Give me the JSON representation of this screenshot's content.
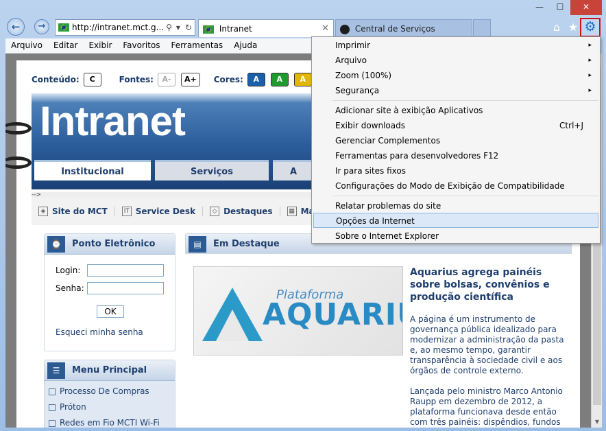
{
  "window": {
    "minimize": "—",
    "maximize": "☐",
    "close": "✕"
  },
  "nav": {
    "back": "←",
    "forward": "→",
    "address": "http://intranet.mct.g...",
    "search_icon": "⚲",
    "dropdown_icon": "▾",
    "refresh_icon": "↻"
  },
  "tabs": [
    {
      "label": "Intranet",
      "close": "✕"
    },
    {
      "label": "Central de Serviços"
    }
  ],
  "toolbar": {
    "home_icon": "⌂",
    "favorites_icon": "★",
    "tools_icon": "⚙"
  },
  "menubar": [
    "Arquivo",
    "Editar",
    "Exibir",
    "Favoritos",
    "Ferramentas",
    "Ajuda"
  ],
  "access_bar": {
    "content_label": "Conteúdo:",
    "content_btn": "C",
    "fonts_label": "Fontes:",
    "font_minus": "A-",
    "font_plus": "A+",
    "colors_label": "Cores:",
    "colors": [
      {
        "label": "A",
        "color": "#1a5fa8"
      },
      {
        "label": "A",
        "color": "#1e9a2e"
      },
      {
        "label": "A",
        "color": "#e3b600"
      }
    ]
  },
  "banner": {
    "title": "Intranet"
  },
  "site_tabs": [
    "Institucional",
    "Serviços",
    "A"
  ],
  "arrow_text": "-->",
  "quick_links": [
    "Site do MCT",
    "Service Desk",
    "Destaques",
    "Map"
  ],
  "ponto": {
    "title": "Ponto Eletrônico",
    "login_label": "Login:",
    "senha_label": "Senha:",
    "ok": "OK",
    "forgot": "Esqueci minha senha"
  },
  "menu_principal": {
    "title": "Menu Principal",
    "items": [
      "Processo De Compras",
      "Próton",
      "Redes em Fio MCTI Wi-Fi"
    ]
  },
  "destaque": {
    "title": "Em Destaque",
    "image_top": "Plataforma",
    "image_main": "AQUARIUS",
    "headline": "Aquarius agrega painéis sobre bolsas, convênios e produção científica",
    "para1": "A página é um instrumento de governança pública idealizado para modernizar a administração da pasta e, ao mesmo tempo, garantir transparência à sociedade civil e aos órgãos de controle externo.",
    "para2": "Lançada pelo ministro Marco Antonio Raupp em dezembro de 2012, a plataforma funcionava desde então com três painéis: dispêndios, fundos"
  },
  "tools_menu": {
    "items": [
      {
        "label": "Imprimir",
        "submenu": "▸"
      },
      {
        "label": "Arquivo",
        "submenu": "▸"
      },
      {
        "label": "Zoom (100%)",
        "submenu": "▸"
      },
      {
        "label": "Segurança",
        "submenu": "▸"
      },
      {
        "label": "Adicionar site à exibição Aplicativos"
      },
      {
        "label": "Exibir downloads",
        "shortcut": "Ctrl+J"
      },
      {
        "label": "Gerenciar Complementos"
      },
      {
        "label": "Ferramentas para desenvolvedores F12"
      },
      {
        "label": "Ir para sites fixos"
      },
      {
        "label": "Configurações do Modo de Exibição de Compatibilidade"
      },
      {
        "label": "Relatar problemas do site"
      },
      {
        "label": "Opções da Internet",
        "highlighted": true
      },
      {
        "label": "Sobre o Internet Explorer"
      }
    ]
  }
}
